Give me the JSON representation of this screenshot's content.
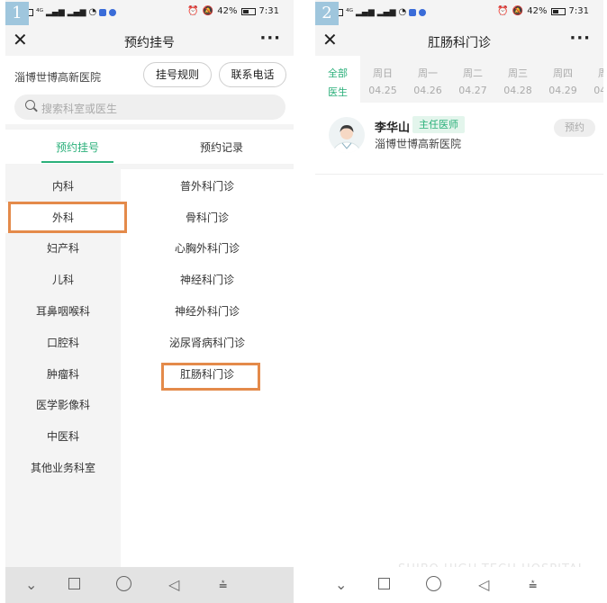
{
  "screen1": {
    "badge": "1",
    "status": {
      "signal": "ᵃˡˡ ᵃˡˡ",
      "battery": "42%",
      "time": "7:31"
    },
    "title": "预约挂号",
    "hospital_name": "淄博世博高新医院",
    "rules_button": "挂号规则",
    "phone_button": "联系电话",
    "search_placeholder": "搜索科室或医生",
    "tabs": [
      "预约挂号",
      "预约记录"
    ],
    "departments": [
      "内科",
      "外科",
      "妇产科",
      "儿科",
      "耳鼻咽喉科",
      "口腔科",
      "肿瘤科",
      "医学影像科",
      "中医科",
      "其他业务科室"
    ],
    "selected_department": "外科",
    "clinics": [
      "普外科门诊",
      "骨科门诊",
      "心胸外科门诊",
      "神经科门诊",
      "神经外科门诊",
      "泌尿肾病科门诊",
      "肛肠科门诊"
    ],
    "highlighted_clinic": "肛肠科门诊"
  },
  "screen2": {
    "badge": "2",
    "status": {
      "battery": "42%",
      "time": "7:31"
    },
    "title": "肛肠科门诊",
    "days": [
      {
        "name": "全部",
        "sub": "医生"
      },
      {
        "name": "周日",
        "sub": "04.25"
      },
      {
        "name": "周一",
        "sub": "04.26"
      },
      {
        "name": "周二",
        "sub": "04.27"
      },
      {
        "name": "周三",
        "sub": "04.28"
      },
      {
        "name": "周四",
        "sub": "04.29"
      },
      {
        "name": "周五",
        "sub": "04.30"
      }
    ],
    "doctor": {
      "name": "李华山",
      "title": "主任医师",
      "hospital": "淄博世博高新医院",
      "book_label": "预约"
    },
    "watermark": "SHIBO HIGH-TECH HOSPITAL"
  },
  "colors": {
    "accent": "#2bb07a",
    "highlight": "#e48a4a",
    "background": "#f4f4f4"
  },
  "icons": [
    "close-icon",
    "more-icon",
    "search-icon",
    "back-icon",
    "home-icon",
    "recents-icon",
    "menu-icon",
    "doctor-avatar"
  ]
}
